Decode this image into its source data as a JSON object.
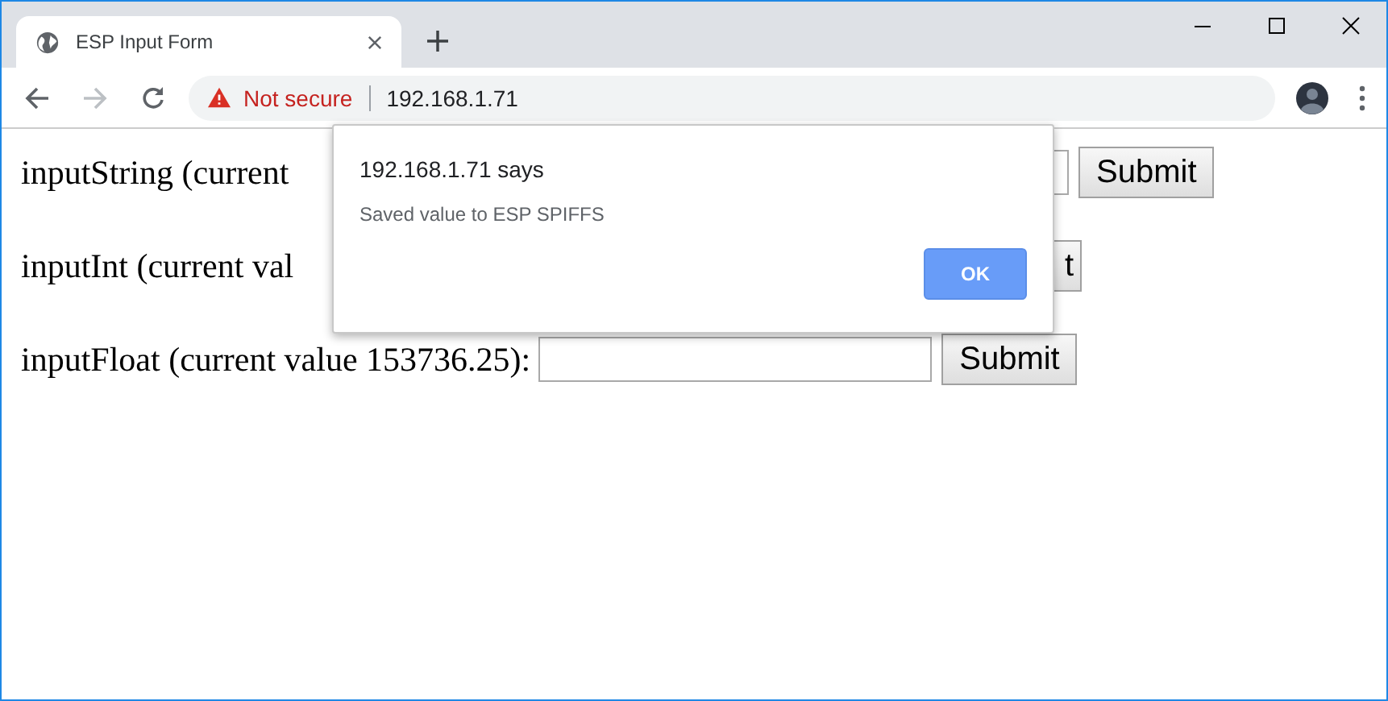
{
  "tab": {
    "title": "ESP Input Form",
    "selected": true
  },
  "toolbar": {
    "back_disabled": false,
    "forward_disabled": true
  },
  "address_bar": {
    "security": "Not secure",
    "url": "192.168.1.71"
  },
  "form_rows": [
    {
      "kind": "field_row",
      "label": "inputString (current",
      "button": "Submit"
    },
    {
      "kind": "button_row",
      "label": "inputInt (current val",
      "button": "t"
    },
    {
      "kind": "field_row",
      "label": "inputFloat (current value 153736.25):",
      "button": "Submit"
    }
  ],
  "dialog": {
    "title": "192.168.1.71 says",
    "message": "Saved value to ESP SPIFFS",
    "button": "OK"
  }
}
